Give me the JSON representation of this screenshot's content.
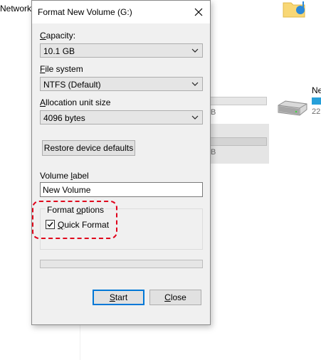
{
  "background": {
    "network_label": "Network",
    "drive_name_partial": "Ne",
    "drive_size_partial": "22",
    "size_suffix_1": "B",
    "size_suffix_2": "B"
  },
  "dialog": {
    "title": "Format New Volume (G:)",
    "capacity": {
      "label_accel": "C",
      "label_rest": "apacity:",
      "value": "10.1 GB"
    },
    "file_system": {
      "label_accel": "F",
      "label_rest": "ile system",
      "value": "NTFS (Default)"
    },
    "allocation": {
      "label_accel": "A",
      "label_rest": "llocation unit size",
      "value": "4096 bytes"
    },
    "restore_button": "Restore device defaults",
    "volume_label": {
      "label_pre": "Volume ",
      "label_accel": "l",
      "label_rest": "abel",
      "value": "New Volume"
    },
    "format_options": {
      "title_pre": "Format ",
      "title_accel": "o",
      "title_rest": "ptions",
      "quick_format_accel": "Q",
      "quick_format_rest": "uick Format",
      "quick_format_checked": true
    },
    "progress": 0,
    "start_button_accel": "S",
    "start_button_rest": "tart",
    "close_button_accel": "C",
    "close_button_rest": "lose"
  },
  "colors": {
    "highlight": "#e0001b",
    "accent": "#0078d7"
  }
}
